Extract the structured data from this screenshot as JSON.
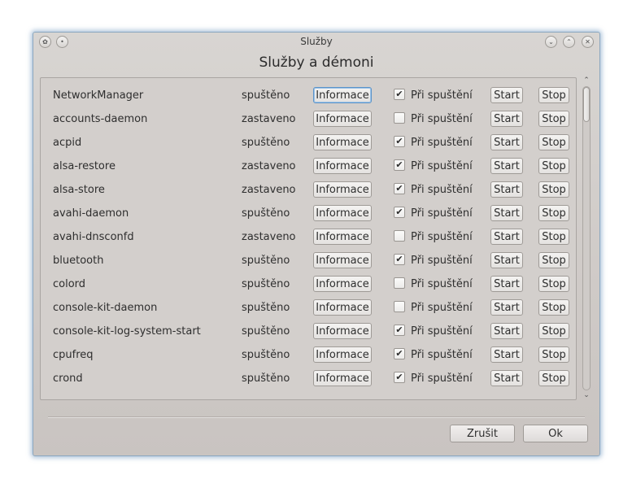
{
  "window": {
    "title": "Služby",
    "heading": "Služby a démoni",
    "controls": [
      "minimize-icon",
      "maximize-icon",
      "close-icon"
    ]
  },
  "list": {
    "info_label": "Informace",
    "onboot_label": "Při spuštění",
    "start_label": "Start",
    "stop_label": "Stop",
    "services": [
      {
        "name": "NetworkManager",
        "status": "spuštěno",
        "on_boot": true
      },
      {
        "name": "accounts-daemon",
        "status": "zastaveno",
        "on_boot": false
      },
      {
        "name": "acpid",
        "status": "spuštěno",
        "on_boot": true
      },
      {
        "name": "alsa-restore",
        "status": "zastaveno",
        "on_boot": true
      },
      {
        "name": "alsa-store",
        "status": "zastaveno",
        "on_boot": true
      },
      {
        "name": "avahi-daemon",
        "status": "spuštěno",
        "on_boot": true
      },
      {
        "name": "avahi-dnsconfd",
        "status": "zastaveno",
        "on_boot": false
      },
      {
        "name": "bluetooth",
        "status": "spuštěno",
        "on_boot": true
      },
      {
        "name": "colord",
        "status": "spuštěno",
        "on_boot": false
      },
      {
        "name": "console-kit-daemon",
        "status": "spuštěno",
        "on_boot": false
      },
      {
        "name": "console-kit-log-system-start",
        "status": "spuštěno",
        "on_boot": true
      },
      {
        "name": "cpufreq",
        "status": "spuštěno",
        "on_boot": true
      },
      {
        "name": "crond",
        "status": "spuštěno",
        "on_boot": true
      }
    ]
  },
  "footer": {
    "cancel_label": "Zrušit",
    "ok_label": "Ok"
  }
}
